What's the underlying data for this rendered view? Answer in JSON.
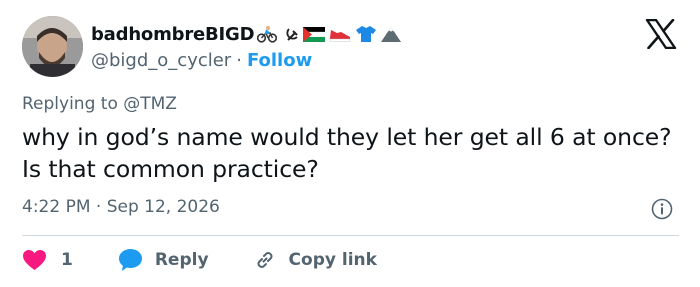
{
  "author": {
    "display_name": "badhombreBIGD",
    "handle": "@bigd_o_cycler",
    "separator": "·",
    "follow_label": "Follow",
    "name_emojis": [
      "bicyclist-icon",
      "hammer-sickle-icon",
      "palestine-flag-icon",
      "sneaker-icon",
      "tshirt-icon",
      "mountain-icon"
    ]
  },
  "tweet": {
    "replying_to": "Replying to @TMZ",
    "text": "why in god’s name would they let her get all 6 at once? Is that common practice?",
    "timestamp": "4:22 PM · Sep 12, 2026"
  },
  "actions": {
    "like_count": "1",
    "reply_label": "Reply",
    "copy_link_label": "Copy link"
  },
  "colors": {
    "accent": "#1d9bf0",
    "like": "#f91880",
    "secondary_text": "#536471",
    "primary_text": "#0f1419",
    "divider": "#cfd9de"
  }
}
